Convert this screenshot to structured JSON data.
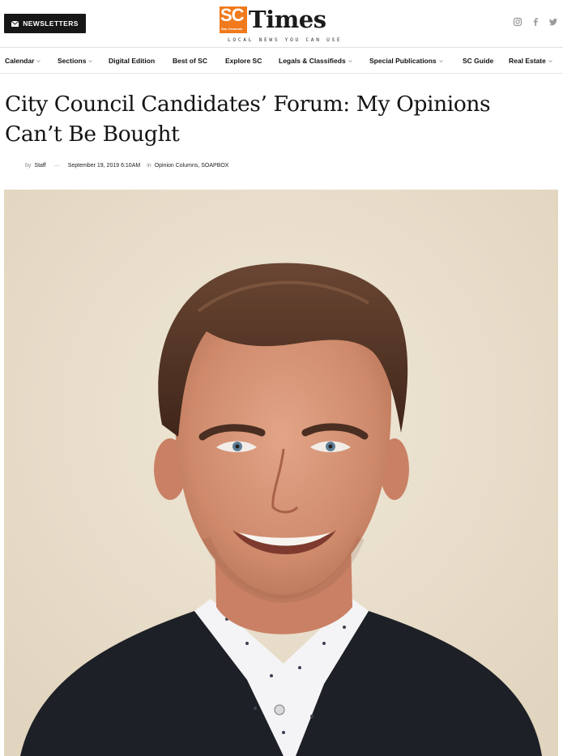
{
  "header": {
    "newsletter_label": "NEWSLETTERS",
    "logo": {
      "sc": "SC",
      "sc_small": "San Clemente",
      "times": "Times",
      "tagline": "LOCAL NEWS YOU CAN USE"
    },
    "social_icons": [
      "instagram-icon",
      "facebook-icon",
      "twitter-icon"
    ]
  },
  "nav": {
    "items": [
      {
        "label": "Calendar",
        "dropdown": true
      },
      {
        "label": "Sections",
        "dropdown": true
      },
      {
        "label": "Digital Edition",
        "dropdown": false
      },
      {
        "label": "Best of SC",
        "dropdown": false
      },
      {
        "label": "Explore SC",
        "dropdown": false
      },
      {
        "label": "Legals & Classifieds",
        "dropdown": true
      },
      {
        "label": "Special Publications",
        "dropdown": true
      },
      {
        "label": "SC Guide",
        "dropdown": false
      },
      {
        "label": "Real Estate",
        "dropdown": true
      }
    ]
  },
  "article": {
    "title_line1": "City Council Candidates’ Forum: My Opinions",
    "title_line2": "Can’t Be Bought",
    "by": "by",
    "author": "Staff",
    "date": "September 19, 2019 6:10AM",
    "in": "in",
    "categories": "Opinion Columns, SOAPBOX"
  },
  "colors": {
    "brand_orange": "#f07a1c",
    "button_dark": "#171717"
  }
}
